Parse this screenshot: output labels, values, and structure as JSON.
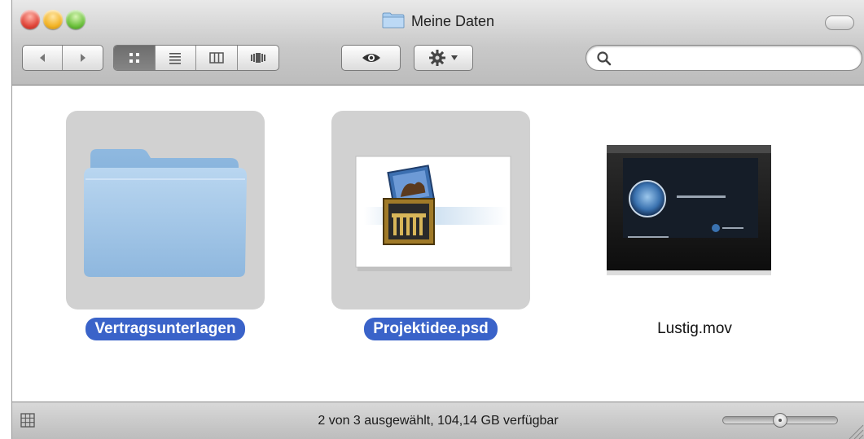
{
  "window": {
    "title": "Meine Daten"
  },
  "toolbar": {
    "nav": [
      "back-icon",
      "forward-icon"
    ],
    "views": [
      {
        "icon": "icon-view-icon",
        "active": true
      },
      {
        "icon": "list-view-icon",
        "active": false
      },
      {
        "icon": "column-view-icon",
        "active": false
      },
      {
        "icon": "coverflow-view-icon",
        "active": false
      }
    ],
    "quicklook_icon": "eye-icon",
    "action_icon": "gear-icon",
    "search": {
      "value": "",
      "placeholder": ""
    }
  },
  "files": [
    {
      "name": "Vertragsunterlagen",
      "kind": "folder",
      "selected": true
    },
    {
      "name": "Projektidee.psd",
      "kind": "image",
      "selected": true
    },
    {
      "name": "Lustig.mov",
      "kind": "movie",
      "selected": false
    }
  ],
  "status": {
    "text": "2 von 3 ausgewählt, 104,14 GB verfügbar",
    "zoom_fraction": 0.5
  },
  "colors": {
    "selection": "#3a63c9",
    "folder_blue": "#9cc3e6"
  }
}
